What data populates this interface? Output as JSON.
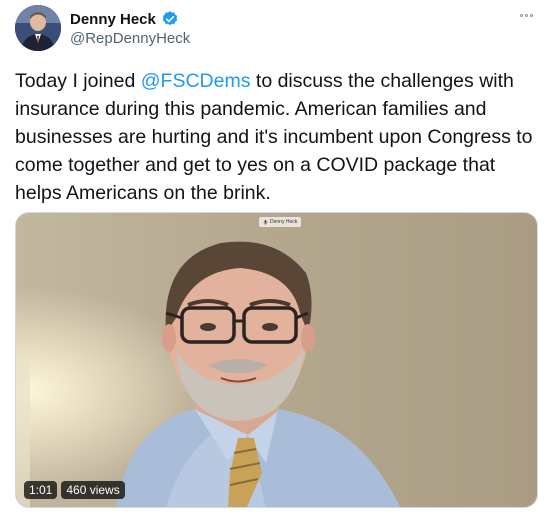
{
  "author": {
    "name": "Denny Heck",
    "handle": "@RepDennyHeck",
    "verified": true,
    "avatar_icon": "avatar"
  },
  "tweet": {
    "text_before": "Today I joined ",
    "mention": "@FSCDems",
    "text_after": " to discuss the challenges with insurance during this pandemic. American families and businesses are hurting and it's incumbent upon Congress to come together and get to yes on a COVID package that helps Americans on the brink."
  },
  "video": {
    "participant_label": "Denny Heck",
    "duration": "1:01",
    "views": "460 views"
  },
  "colors": {
    "link": "#1d9bf0",
    "verified": "#1d9bf0",
    "handle": "#536471"
  }
}
